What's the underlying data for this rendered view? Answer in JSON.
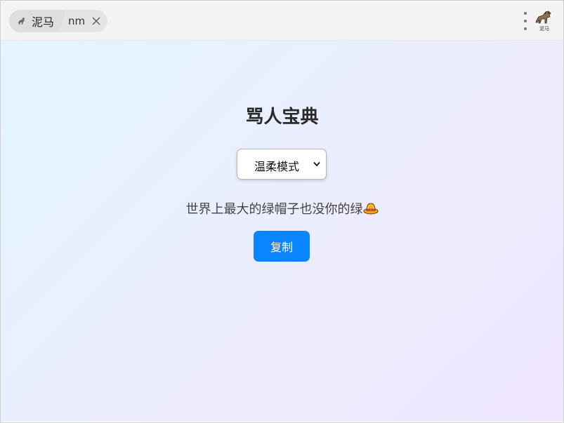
{
  "tab": {
    "title": "泥马",
    "subtitle": "nm"
  },
  "header": {
    "logo_caption": "泥马"
  },
  "main": {
    "title": "骂人宝典",
    "mode_select": {
      "selected": "温柔模式"
    },
    "message": "世界上最大的绿帽子也没你的绿",
    "message_icon": "green-hat-emoji",
    "copy_label": "复制"
  },
  "colors": {
    "accent": "#0a84ff",
    "gradient_start": "#e3f5ff",
    "gradient_end": "#efe6fd"
  }
}
